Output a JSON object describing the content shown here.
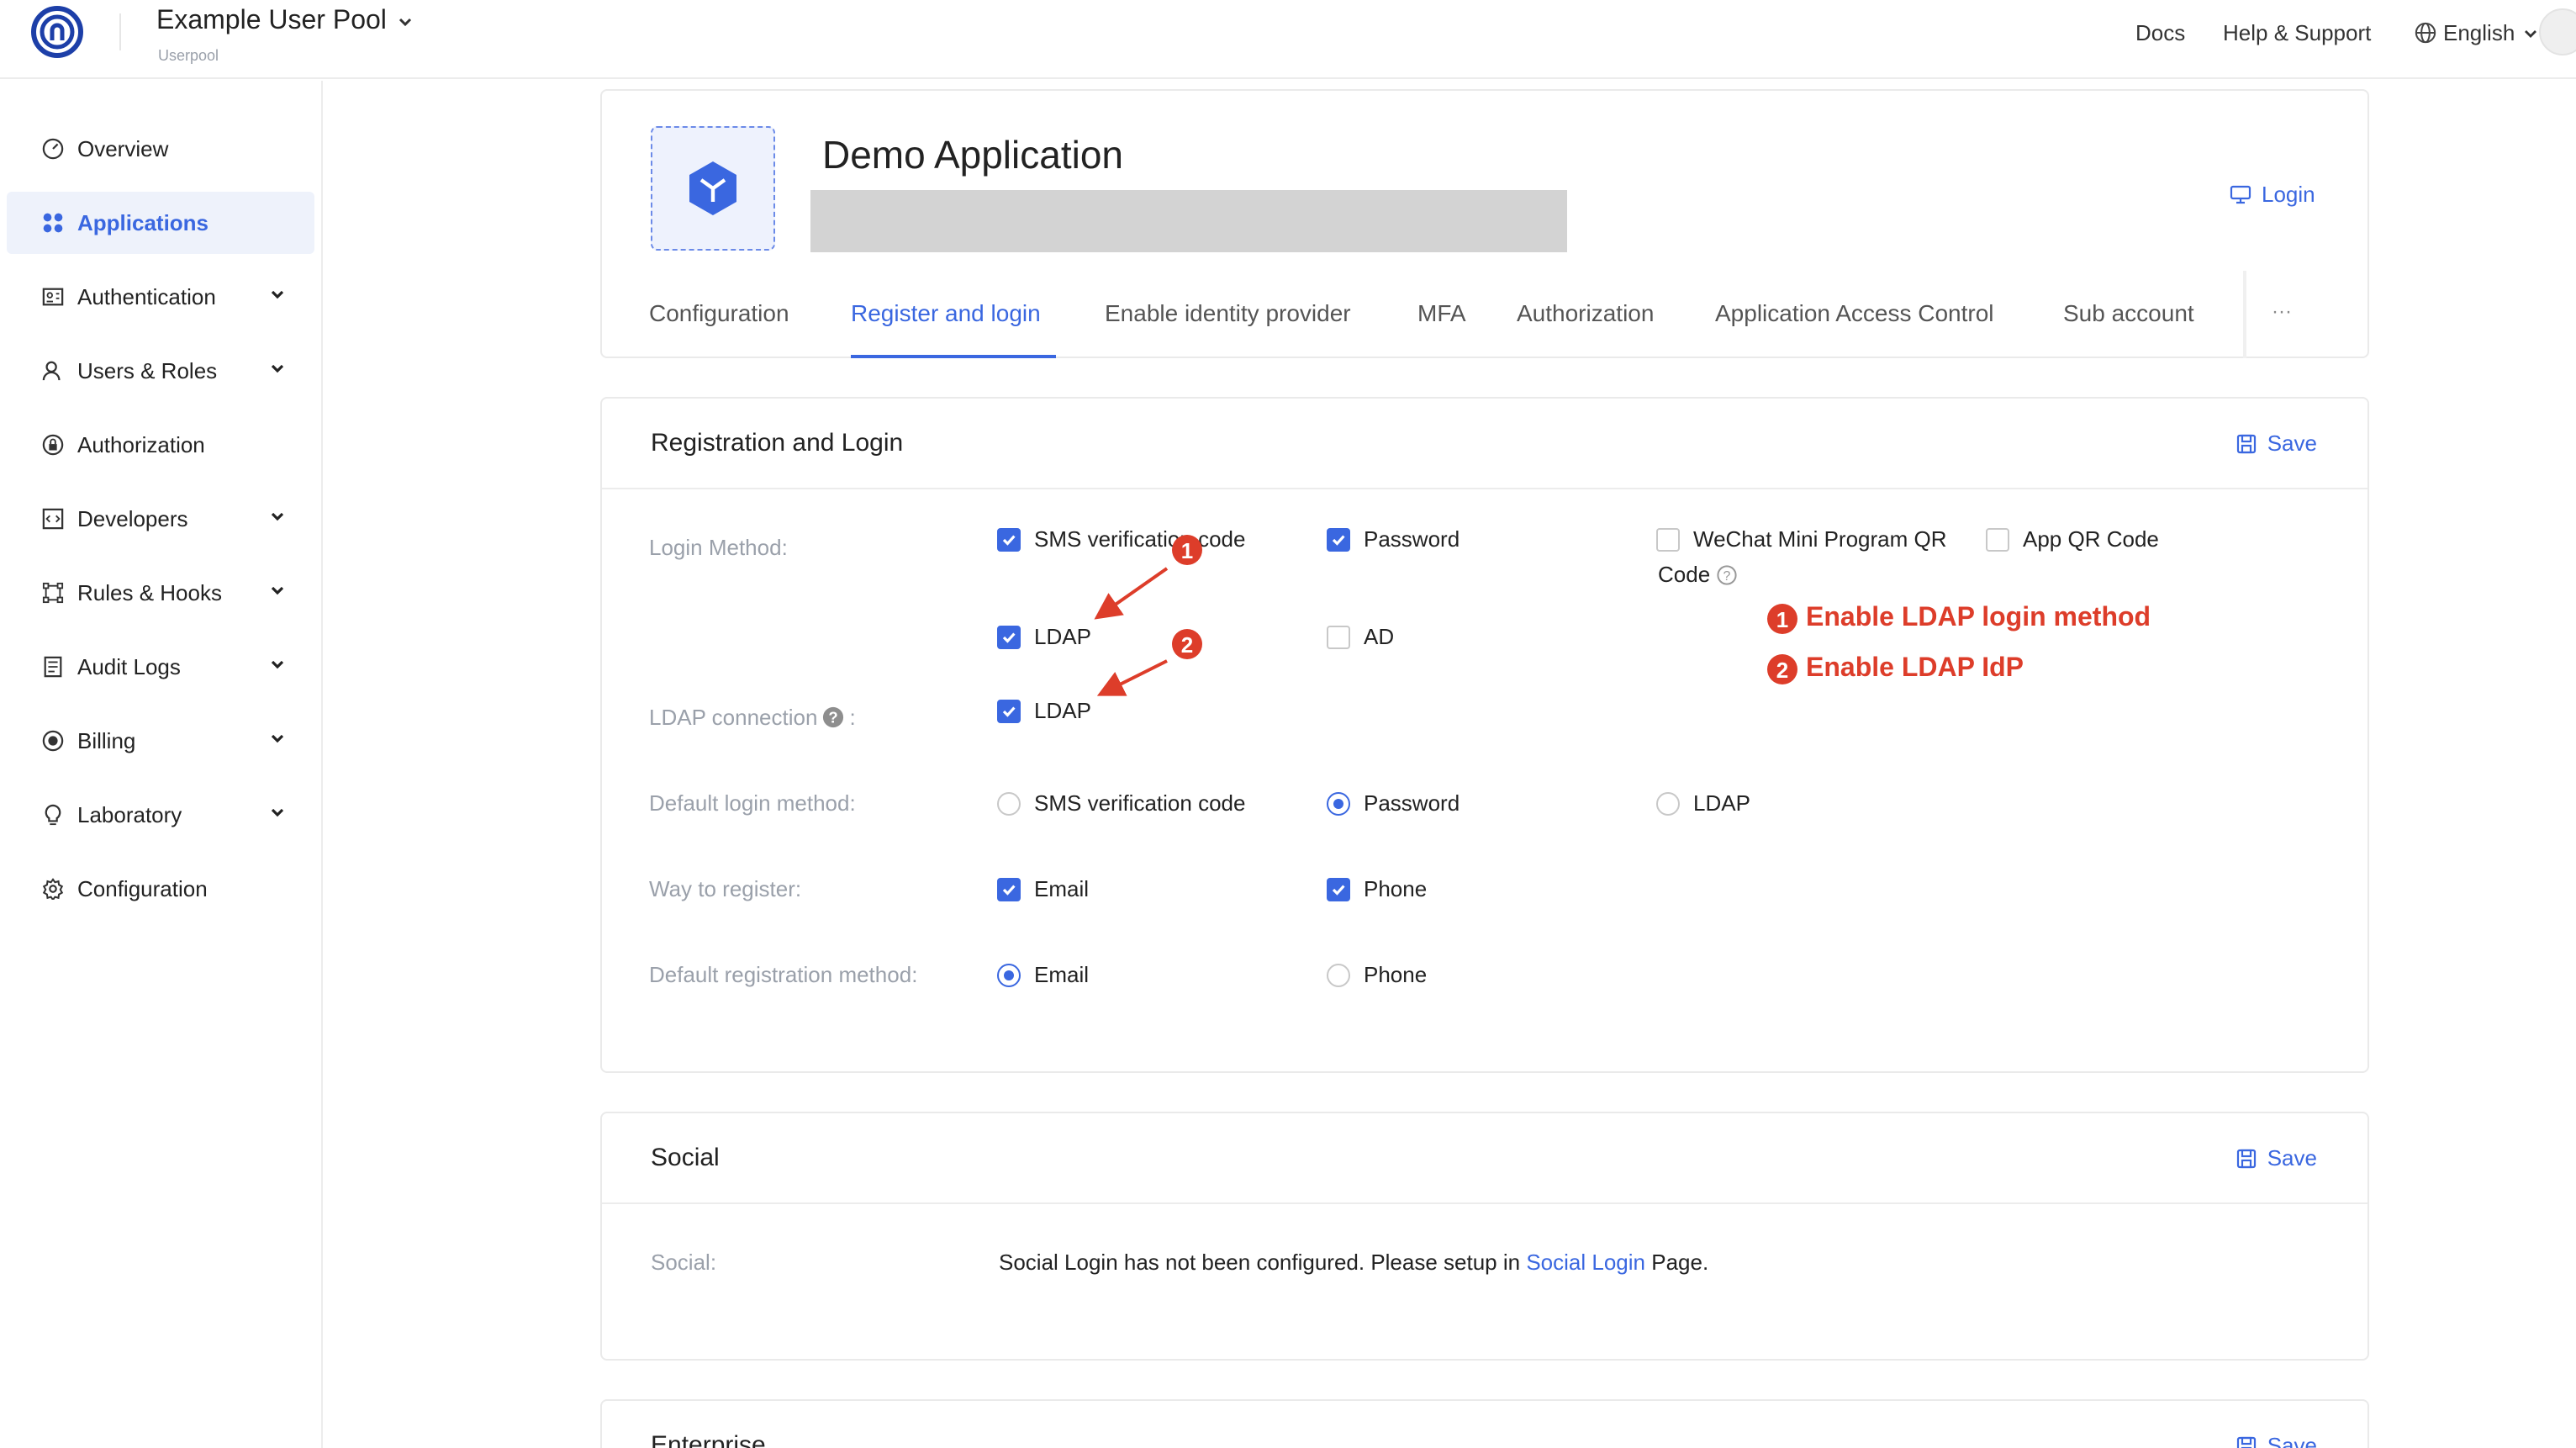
{
  "header": {
    "pool_name": "Example User Pool",
    "pool_sub": "Userpool",
    "docs": "Docs",
    "help": "Help & Support",
    "language": "English"
  },
  "sidebar": {
    "items": [
      {
        "label": "Overview",
        "icon": "dashboard-icon",
        "expandable": false,
        "active": false
      },
      {
        "label": "Applications",
        "icon": "apps-icon",
        "expandable": false,
        "active": true
      },
      {
        "label": "Authentication",
        "icon": "id-card-icon",
        "expandable": true,
        "active": false
      },
      {
        "label": "Users & Roles",
        "icon": "user-icon",
        "expandable": true,
        "active": false
      },
      {
        "label": "Authorization",
        "icon": "lock-icon",
        "expandable": false,
        "active": false
      },
      {
        "label": "Developers",
        "icon": "code-icon",
        "expandable": true,
        "active": false
      },
      {
        "label": "Rules & Hooks",
        "icon": "rules-icon",
        "expandable": true,
        "active": false
      },
      {
        "label": "Audit Logs",
        "icon": "log-icon",
        "expandable": true,
        "active": false
      },
      {
        "label": "Billing",
        "icon": "billing-icon",
        "expandable": true,
        "active": false
      },
      {
        "label": "Laboratory",
        "icon": "bulb-icon",
        "expandable": true,
        "active": false
      },
      {
        "label": "Configuration",
        "icon": "gear-icon",
        "expandable": false,
        "active": false
      }
    ]
  },
  "app": {
    "name": "Demo Application",
    "login_link": "Login",
    "tabs": [
      "Configuration",
      "Register and login",
      "Enable identity provider",
      "MFA",
      "Authorization",
      "Application Access Control",
      "Sub account"
    ],
    "active_tab": "Register and login",
    "more": "···"
  },
  "registration": {
    "title": "Registration and Login",
    "save": "Save",
    "login_method_label": "Login Method",
    "login_methods": [
      {
        "label": "SMS verification code",
        "checked": true
      },
      {
        "label": "Password",
        "checked": true
      },
      {
        "label": "WeChat Mini Program QR",
        "label2": "Code",
        "checked": false
      },
      {
        "label": "App QR Code",
        "checked": false
      },
      {
        "label": "LDAP",
        "checked": true
      },
      {
        "label": "AD",
        "checked": false
      }
    ],
    "ldap_label": "LDAP connection",
    "ldap_option": {
      "label": "LDAP",
      "checked": true
    },
    "default_login_label": "Default login method",
    "default_login": [
      {
        "label": "SMS verification code",
        "selected": false
      },
      {
        "label": "Password",
        "selected": true
      },
      {
        "label": "LDAP",
        "selected": false
      }
    ],
    "register_label": "Way to register",
    "register": [
      {
        "label": "Email",
        "checked": true
      },
      {
        "label": "Phone",
        "checked": true
      }
    ],
    "default_register_label": "Default registration method",
    "default_register": [
      {
        "label": "Email",
        "selected": true
      },
      {
        "label": "Phone",
        "selected": false
      }
    ]
  },
  "annotations": [
    {
      "num": "1",
      "text": "Enable LDAP login method"
    },
    {
      "num": "2",
      "text": "Enable LDAP IdP"
    }
  ],
  "social": {
    "title": "Social",
    "save": "Save",
    "label": "Social",
    "message_before": "Social Login has not been configured. Please setup in ",
    "link": "Social Login",
    "message_after": " Page."
  },
  "enterprise": {
    "title": "Enterprise",
    "save": "Save"
  },
  "colors": {
    "accent": "#3a67e0",
    "annotation": "#dd3d2a"
  }
}
